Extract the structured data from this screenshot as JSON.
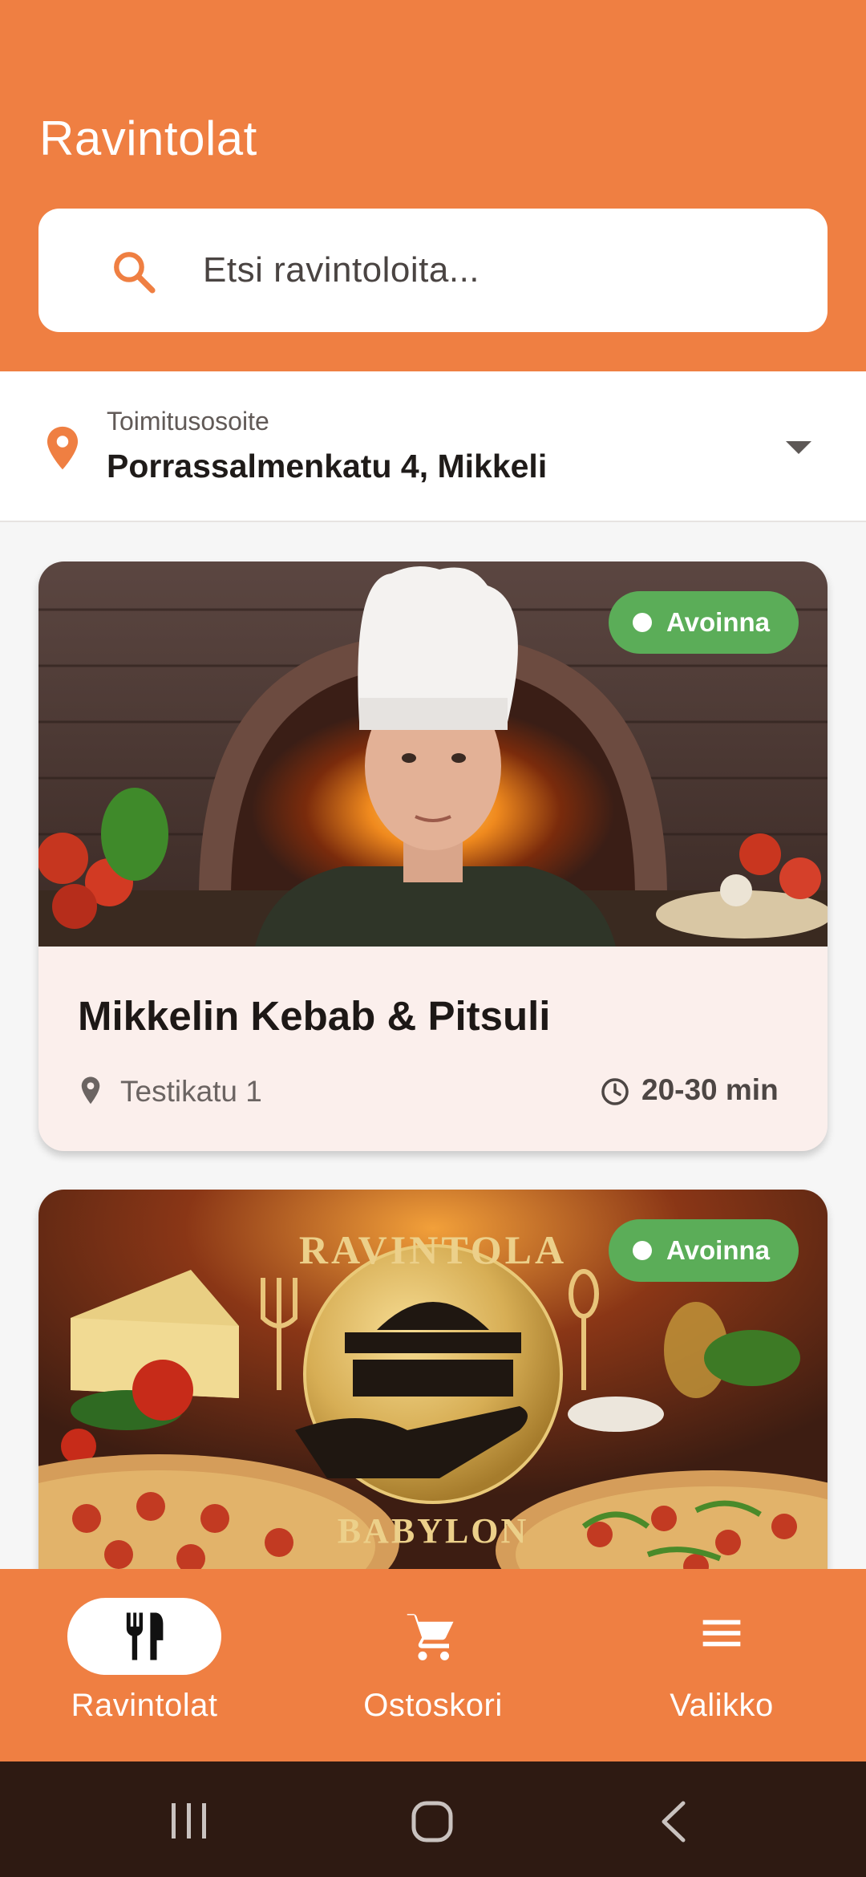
{
  "header": {
    "title": "Ravintolat"
  },
  "search": {
    "placeholder": "Etsi ravintoloita...",
    "icon": "search-icon"
  },
  "address": {
    "label": "Toimitusosoite",
    "value": "Porrassalmenkatu 4, Mikkeli",
    "icon": "location-pin-icon"
  },
  "restaurants": [
    {
      "name": "Mikkelin Kebab & Pitsuli",
      "status": "Avoinna",
      "address": "Testikatu 1",
      "delivery_time": "20-30 min"
    },
    {
      "name": "",
      "status": "Avoinna",
      "logo_text_top": "RAVINTOLA",
      "logo_text_bottom": "BABYLON"
    }
  ],
  "bottom_nav": [
    {
      "label": "Ravintolat",
      "icon": "restaurant-cutlery-icon",
      "active": true
    },
    {
      "label": "Ostoskori",
      "icon": "shopping-cart-icon",
      "active": false
    },
    {
      "label": "Valikko",
      "icon": "menu-icon",
      "active": false
    }
  ],
  "colors": {
    "primary": "#ef7f42",
    "open_badge": "#5bad58",
    "card_bg": "#fbefec",
    "system_bar": "#2e1a12"
  }
}
